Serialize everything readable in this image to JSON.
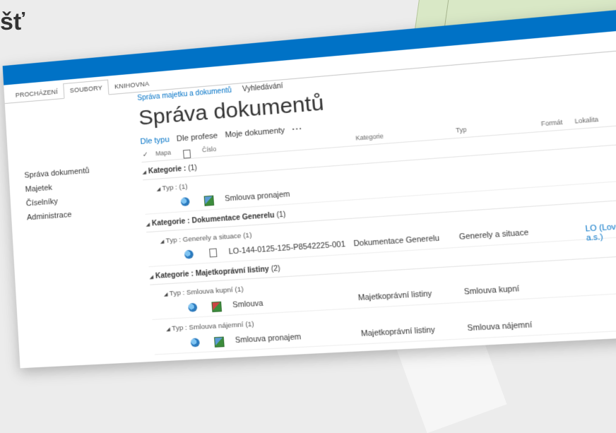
{
  "background": {
    "title_fragment": "šť"
  },
  "ribbon": {
    "tabs": [
      {
        "label": "PROCHÁZENÍ"
      },
      {
        "label": "SOUBORY"
      },
      {
        "label": "KNIHOVNA"
      }
    ]
  },
  "left_nav": {
    "items": [
      "Správa dokumentů",
      "Majetek",
      "Číselníky",
      "Administrace"
    ]
  },
  "breadcrumb": {
    "link": "Správa majetku a dokumentů",
    "search": "Vyhledávání"
  },
  "page_title": "Správa dokumentů",
  "views": {
    "active": "Dle typu",
    "profession": "Dle profese",
    "mine": "Moje dokumenty",
    "more": "···"
  },
  "columns": {
    "check": "✓",
    "map": "Mapa",
    "number": "Číslo",
    "category": "Kategorie",
    "type": "Typ",
    "format": "Formát",
    "location": "Lokalita",
    "extra": "F"
  },
  "groups": [
    {
      "category_prefix": "Kategorie :",
      "category_name": "",
      "category_count": "(1)",
      "type_label": "Typ : (1)",
      "row": {
        "number": "Smlouva pronajem",
        "category": "",
        "type": "",
        "location": ""
      }
    },
    {
      "category_prefix": "Kategorie :",
      "category_name": "Dokumentace Generelu",
      "category_count": "(1)",
      "type_label": "Typ : Generely a situace (1)",
      "row": {
        "number": "LO-144-0125-125-P8542225-001",
        "category": "Dokumentace Generelu",
        "type": "Generely a situace",
        "location": "LO (Lovochemie, a.s.)"
      }
    },
    {
      "category_prefix": "Kategorie :",
      "category_name": "Majetkoprávní listiny",
      "category_count": "(2)",
      "subgroups": [
        {
          "type_label": "Typ : Smlouva kupní (1)",
          "row": {
            "number": "Smlouva",
            "category": "Majetkoprávní listiny",
            "type": "Smlouva kupní"
          }
        },
        {
          "type_label": "Typ : Smlouva nájemní (1)",
          "row": {
            "number": "Smlouva pronajem",
            "category": "Majetkoprávní listiny",
            "type": "Smlouva nájemní"
          }
        }
      ]
    }
  ],
  "icons": {
    "suite_bar_color": "#0072c6",
    "map": "globe-map-icon",
    "excel": "excel-file-icon",
    "document": "document-icon"
  }
}
